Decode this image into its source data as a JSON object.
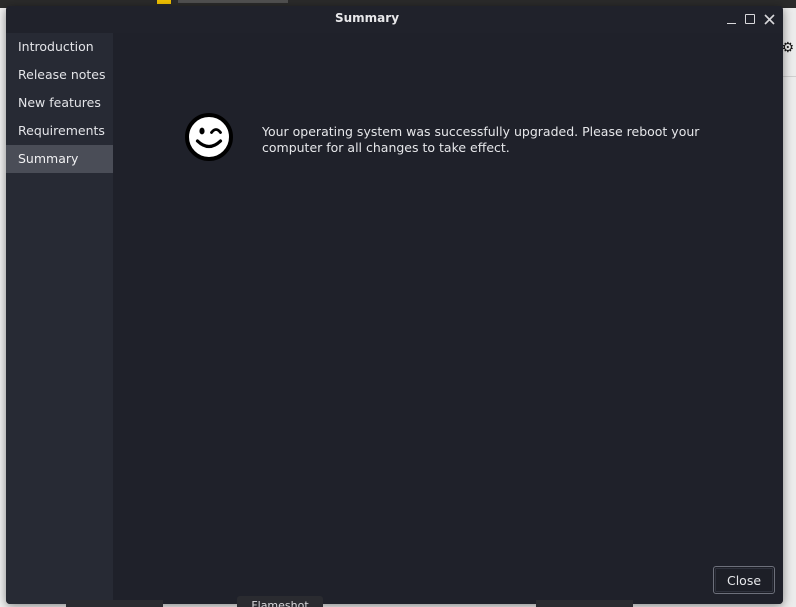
{
  "window": {
    "title": "Summary"
  },
  "sidebar": {
    "items": [
      {
        "label": "Introduction",
        "active": false
      },
      {
        "label": "Release notes",
        "active": false
      },
      {
        "label": "New features",
        "active": false
      },
      {
        "label": "Requirements",
        "active": false
      },
      {
        "label": "Summary",
        "active": true
      }
    ]
  },
  "main": {
    "icon": "wink-smiley-icon",
    "message": "Your operating system was successfully upgraded. Please reboot your computer for all changes to take effect."
  },
  "footer": {
    "close_label": "Close"
  },
  "taskbar": {
    "peek_label": "Flameshot"
  },
  "colors": {
    "window_bg": "#1f212a",
    "sidebar_bg": "#272a34",
    "sidebar_active": "#4a4d57",
    "text": "#e6e7ea"
  }
}
